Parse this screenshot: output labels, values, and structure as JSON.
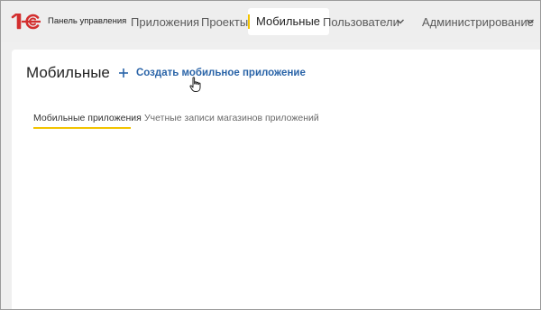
{
  "header": {
    "logo_text": "1С",
    "panel_title": "Панель управления",
    "nav": [
      {
        "label": "Приложения"
      },
      {
        "label": "Проекты"
      },
      {
        "label": "Мобильные",
        "active": true
      },
      {
        "label": "Пользователи"
      },
      {
        "label": "Администрирование"
      }
    ]
  },
  "main": {
    "title": "Мобильные",
    "create_button_label": "Создать мобильное приложение",
    "tabs": [
      {
        "label": "Мобильные приложения",
        "active": true
      },
      {
        "label": "Учетные записи магазинов приложений"
      }
    ]
  },
  "colors": {
    "accent_yellow": "#f2c300",
    "link_blue": "#2a64a8",
    "logo_red": "#d32f2f"
  },
  "icons": [
    "logo-1c",
    "chevron-down-icon",
    "plus-icon",
    "hand-cursor-icon"
  ]
}
